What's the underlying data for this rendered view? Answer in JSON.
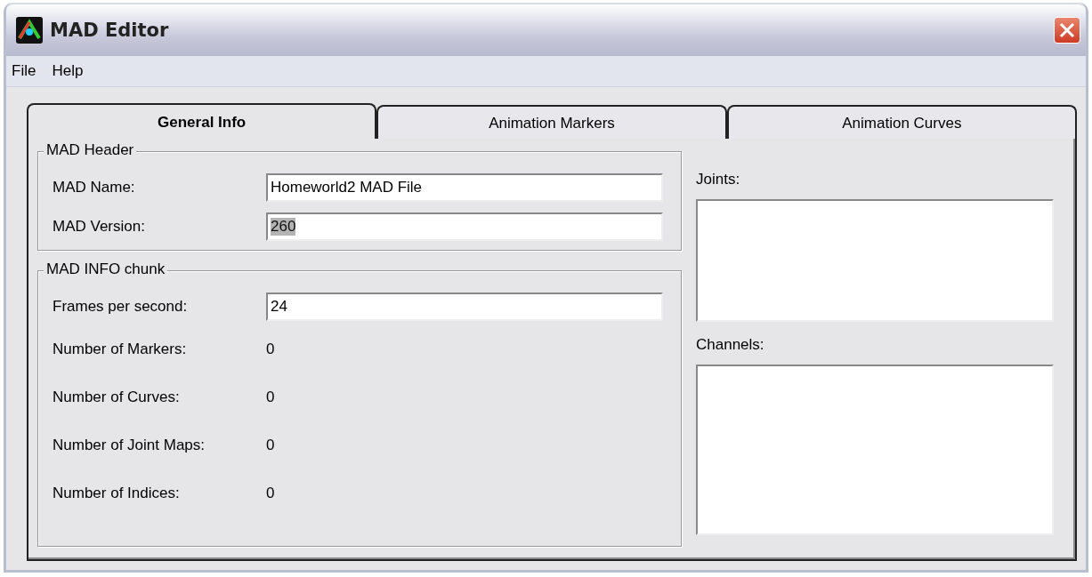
{
  "window": {
    "title": "MAD Editor"
  },
  "menu": [
    "File",
    "Help"
  ],
  "tabs": [
    {
      "label": "General Info",
      "selected": true
    },
    {
      "label": "Animation Markers",
      "selected": false
    },
    {
      "label": "Animation Curves",
      "selected": false
    }
  ],
  "header_group": {
    "title": "MAD Header",
    "fields": [
      {
        "label": "MAD Name:",
        "value": "Homeworld2 MAD File",
        "text_selected": false
      },
      {
        "label": "MAD Version:",
        "value": "260",
        "text_selected": true
      }
    ]
  },
  "info_group": {
    "title": "MAD INFO chunk",
    "fps": {
      "label": "Frames per second:",
      "value": "24",
      "text_selected": false
    },
    "counts": [
      {
        "label": "Number of Markers:",
        "value": "0"
      },
      {
        "label": "Number of Curves:",
        "value": "0"
      },
      {
        "label": "Number of Joint Maps:",
        "value": "0"
      },
      {
        "label": "Number of Indices:",
        "value": "0"
      }
    ]
  },
  "lists": [
    {
      "label": "Joints:",
      "kind": "short"
    },
    {
      "label": "Channels:",
      "kind": "tall"
    }
  ]
}
